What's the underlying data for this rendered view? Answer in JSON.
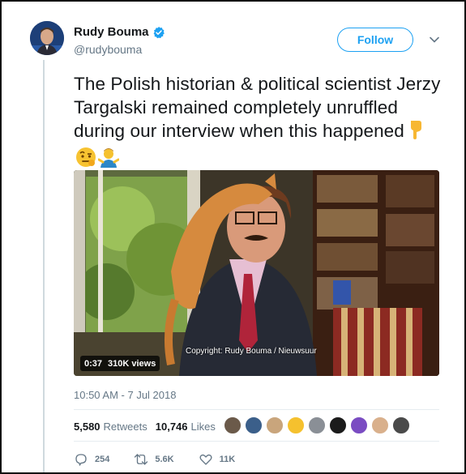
{
  "author": {
    "display_name": "Rudy Bouma",
    "handle": "@rudybouma",
    "verified": true
  },
  "follow_label": "Follow",
  "tweet": {
    "text": "The Polish historian & political scientist Jerzy Targalski remained completely unruffled during our interview when this happened",
    "emojis": [
      "backhand-index-pointing-down",
      "face-with-raised-eyebrow",
      "man-shrugging"
    ]
  },
  "media": {
    "copyright": "Copyright: Rudy Bouma / Nieuwsuur",
    "duration": "0:37",
    "views": "310K views"
  },
  "timestamp": "10:50 AM - 7 Jul 2018",
  "stats": {
    "retweets_count": "5,580",
    "retweets_label": "Retweets",
    "likes_count": "10,746",
    "likes_label": "Likes"
  },
  "actions": {
    "replies": "254",
    "retweets": "5.6K",
    "likes": "11K"
  },
  "colors": {
    "accent": "#1da1f2",
    "muted": "#657786",
    "text": "#14171a"
  }
}
